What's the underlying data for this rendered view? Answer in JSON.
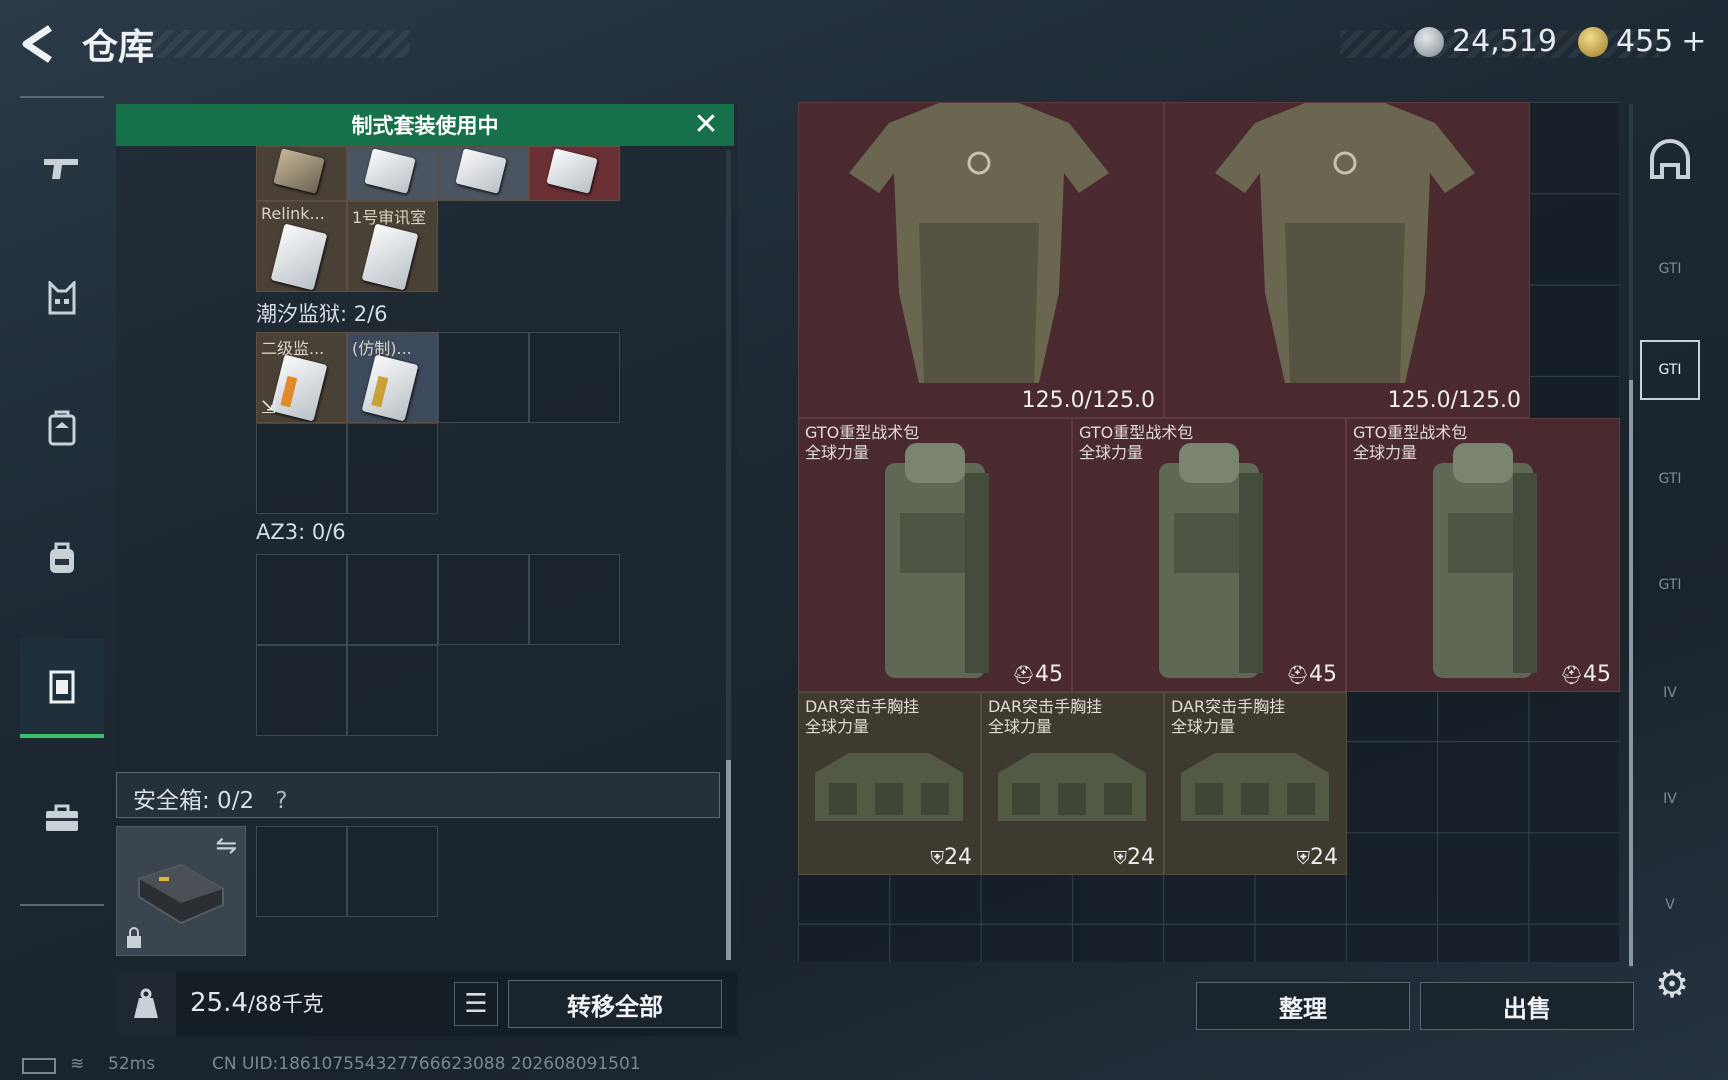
{
  "header": {
    "title": "仓库",
    "currency_silver": "24,519",
    "currency_gold": "455",
    "add_label": "+"
  },
  "left_tabs": [
    {
      "icon": "pistol-icon"
    },
    {
      "icon": "vest-icon"
    },
    {
      "icon": "armor-icon"
    },
    {
      "icon": "backpack-icon"
    },
    {
      "icon": "rig-icon"
    },
    {
      "icon": "briefcase-icon"
    }
  ],
  "banner": {
    "text": "制式套装使用中"
  },
  "containers": [
    {
      "items": [
        {
          "label": "Relink..."
        },
        {
          "label": "1号审讯室"
        }
      ]
    },
    {
      "name": "潮汐监狱: 2/6",
      "items": [
        {
          "label": "二级监..."
        },
        {
          "label": "(仿制)..."
        }
      ]
    },
    {
      "name": "AZ3: 0/6"
    }
  ],
  "safe_box": {
    "label": "安全箱: 0/2",
    "help": "?"
  },
  "bottom": {
    "weight_value": "25.4",
    "weight_max": "/88千克",
    "transfer_label": "转移全部"
  },
  "grid": {
    "armor": [
      {
        "durability": "125.0/125.0"
      },
      {
        "durability": "125.0/125.0"
      }
    ],
    "backpacks": [
      {
        "name": "GTO重型战术包",
        "sub": "全球力量",
        "capacity": "45"
      },
      {
        "name": "GTO重型战术包",
        "sub": "全球力量",
        "capacity": "45"
      },
      {
        "name": "GTO重型战术包",
        "sub": "全球力量",
        "capacity": "45"
      }
    ],
    "rigs": [
      {
        "name": "DAR突击手胸挂",
        "sub": "全球力量",
        "capacity": "24"
      },
      {
        "name": "DAR突击手胸挂",
        "sub": "全球力量",
        "capacity": "24"
      },
      {
        "name": "DAR突击手胸挂",
        "sub": "全球力量",
        "capacity": "24"
      }
    ]
  },
  "actions": {
    "sort_label": "整理",
    "sell_label": "出售"
  },
  "right_tabs": [
    {
      "label": "GTI"
    },
    {
      "label": "GTI"
    },
    {
      "label": "GTI"
    },
    {
      "label": "GTI"
    },
    {
      "label": "IV"
    },
    {
      "label": "IV"
    },
    {
      "label": "V"
    }
  ],
  "footer": {
    "ping": "52ms",
    "uid": "CN UID:186107554327766623088 202608091501"
  }
}
